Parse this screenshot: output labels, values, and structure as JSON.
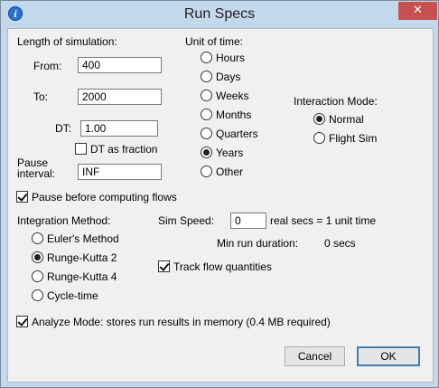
{
  "window": {
    "title": "Run Specs",
    "info_icon": "i",
    "close_icon": "✕"
  },
  "simulation": {
    "heading": "Length of simulation:",
    "from_label": "From:",
    "from_value": "400",
    "to_label": "To:",
    "to_value": "2000",
    "dt_label": "DT:",
    "dt_value": "1.00",
    "dt_fraction_label": "DT as fraction",
    "dt_fraction_checked": false,
    "pause_label_1": "Pause",
    "pause_label_2": "interval:",
    "pause_value": "INF",
    "pause_before_label": "Pause before computing flows",
    "pause_before_checked": true
  },
  "time_unit": {
    "heading": "Unit of time:",
    "options": [
      "Hours",
      "Days",
      "Weeks",
      "Months",
      "Quarters",
      "Years",
      "Other"
    ],
    "selected": "Years"
  },
  "interaction": {
    "heading": "Interaction Mode:",
    "options": [
      "Normal",
      "Flight Sim"
    ],
    "selected": "Normal"
  },
  "integration": {
    "heading": "Integration Method:",
    "options": [
      "Euler's Method",
      "Runge-Kutta 2",
      "Runge-Kutta 4",
      "Cycle-time"
    ],
    "selected": "Runge-Kutta 2"
  },
  "sim_speed": {
    "label": "Sim Speed:",
    "value": "0",
    "suffix": "real secs = 1 unit time",
    "min_run_label": "Min run duration:",
    "min_run_value": "0 secs",
    "track_flow_label": "Track flow quantities",
    "track_flow_checked": true
  },
  "analyze": {
    "label": "Analyze Mode: stores run results in memory (0.4 MB required)",
    "checked": true
  },
  "buttons": {
    "cancel": "Cancel",
    "ok": "OK"
  }
}
